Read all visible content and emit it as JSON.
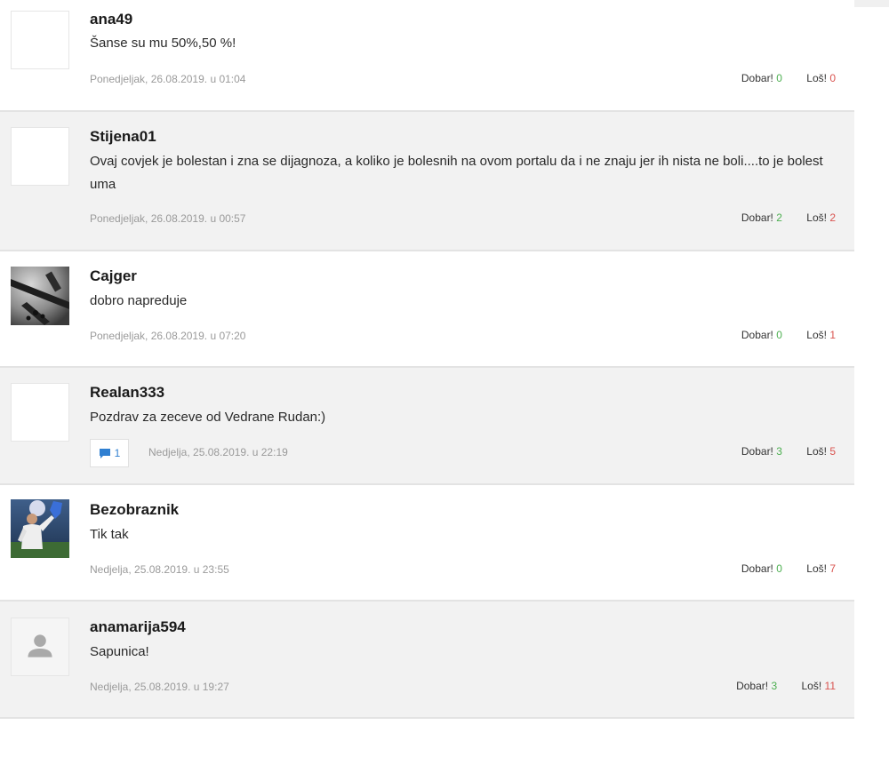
{
  "comments": [
    {
      "user": "ana49",
      "text": "Šanse su mu 50%,50 %!",
      "date": "Ponedjeljak, 26.08.2019. u 01:04",
      "good_label": "Dobar!",
      "good_count": "0",
      "bad_label": "Loš!",
      "bad_count": "0"
    },
    {
      "user": "Stijena01",
      "text": "Ovaj covjek je bolestan i zna se dijagnoza, a koliko je bolesnih na ovom portalu da i ne znaju jer ih nista ne boli....to je bolest uma",
      "date": "Ponedjeljak, 26.08.2019. u 00:57",
      "good_label": "Dobar!",
      "good_count": "2",
      "bad_label": "Loš!",
      "bad_count": "2"
    },
    {
      "user": "Cajger",
      "text": "dobro napreduje",
      "date": "Ponedjeljak, 26.08.2019. u 07:20",
      "good_label": "Dobar!",
      "good_count": "0",
      "bad_label": "Loš!",
      "bad_count": "1"
    },
    {
      "user": "Realan333",
      "text": "Pozdrav za zeceve od Vedrane Rudan:)",
      "replies": "1",
      "date": "Nedjelja, 25.08.2019. u 22:19",
      "good_label": "Dobar!",
      "good_count": "3",
      "bad_label": "Loš!",
      "bad_count": "5"
    },
    {
      "user": "Bezobraznik",
      "text": "Tik tak",
      "date": "Nedjelja, 25.08.2019. u 23:55",
      "good_label": "Dobar!",
      "good_count": "0",
      "bad_label": "Loš!",
      "bad_count": "7"
    },
    {
      "user": "anamarija594",
      "text": "Sapunica!",
      "date": "Nedjelja, 25.08.2019. u 19:27",
      "good_label": "Dobar!",
      "good_count": "3",
      "bad_label": "Loš!",
      "bad_count": "11"
    }
  ],
  "colors": {
    "good": "#4caf50",
    "bad": "#d9534f",
    "reply": "#2f7fd1",
    "row_alt": "#f2f2f2"
  },
  "icons": {
    "reply": "speech-bubble-icon",
    "default_avatar": "user-silhouette-icon"
  }
}
